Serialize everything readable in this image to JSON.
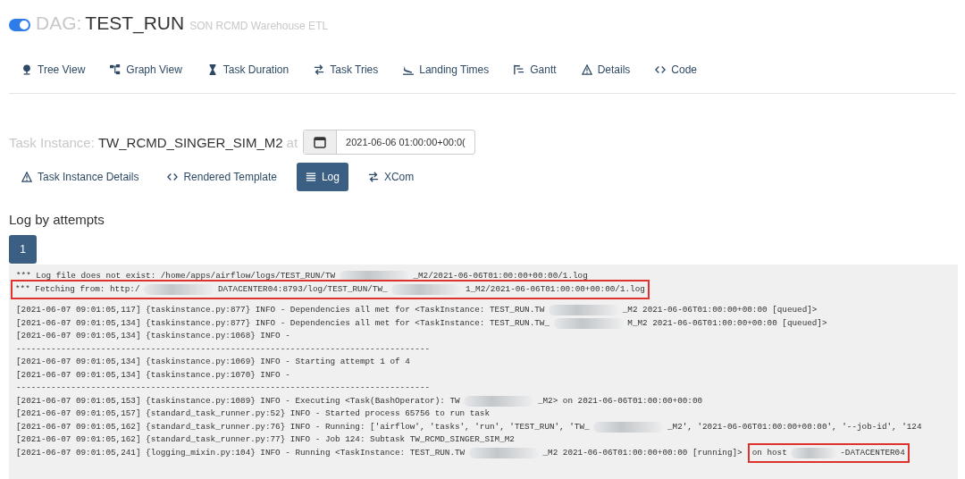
{
  "dag": {
    "on": true,
    "label": "DAG:",
    "name": "TEST_RUN",
    "description": "SON RCMD Warehouse ETL"
  },
  "nav": [
    {
      "label": "Tree View"
    },
    {
      "label": "Graph View"
    },
    {
      "label": "Task Duration"
    },
    {
      "label": "Task Tries"
    },
    {
      "label": "Landing Times"
    },
    {
      "label": "Gantt"
    },
    {
      "label": "Details"
    },
    {
      "label": "Code"
    }
  ],
  "task_instance": {
    "label": "Task Instance:",
    "name": "TW_RCMD_SINGER_SIM_M2",
    "at": "at",
    "date": "2021-06-06 01:00:00+00:0("
  },
  "tabs": [
    {
      "label": "Task Instance Details",
      "selected": false
    },
    {
      "label": "Rendered Template",
      "selected": false
    },
    {
      "label": "Log",
      "selected": true
    },
    {
      "label": "XCom",
      "selected": false
    }
  ],
  "log_heading": "Log by attempts",
  "attempts": [
    {
      "label": "1",
      "selected": true
    }
  ],
  "log_lines": [
    {
      "kind": "text",
      "highlighted": false,
      "segments": [
        "*** Log file does not exist: /home/apps/airflow/logs/TEST_RUN/TW",
        "_M2/2021-06-06T01:00:00+00:00/1.log"
      ]
    },
    {
      "kind": "text",
      "highlighted": true,
      "segments": [
        "*** Fetching from: http:/",
        "DATACENTER04:8793/log/TEST_RUN/TW_",
        "1_M2/2021-06-06T01:00:00+00:00/1.log"
      ]
    },
    {
      "kind": "blank"
    },
    {
      "kind": "text",
      "highlighted": false,
      "segments": [
        "[2021-06-07 09:01:05,117] {taskinstance.py:877} INFO - Dependencies all met for <TaskInstance: TEST_RUN.TW",
        "_M2 2021-06-06T01:00:00+00:00 [queued]>"
      ]
    },
    {
      "kind": "text",
      "highlighted": false,
      "segments": [
        "[2021-06-07 09:01:05,134] {taskinstance.py:877} INFO - Dependencies all met for <TaskInstance: TEST_RUN.TW_",
        "M_M2 2021-06-06T01:00:00+00:00 [queued]>"
      ]
    },
    {
      "kind": "text",
      "highlighted": false,
      "segments": [
        "[2021-06-07 09:01:05,134] {taskinstance.py:1068} INFO -"
      ]
    },
    {
      "kind": "text",
      "highlighted": false,
      "segments": [
        "-----------------------------------------------------------------------------------"
      ]
    },
    {
      "kind": "text",
      "highlighted": false,
      "segments": [
        "[2021-06-07 09:01:05,134] {taskinstance.py:1069} INFO - Starting attempt 1 of 4"
      ]
    },
    {
      "kind": "text",
      "highlighted": false,
      "segments": [
        "[2021-06-07 09:01:05,134] {taskinstance.py:1070} INFO -"
      ]
    },
    {
      "kind": "text",
      "highlighted": false,
      "segments": [
        "-----------------------------------------------------------------------------------"
      ]
    },
    {
      "kind": "text",
      "highlighted": false,
      "segments": [
        "[2021-06-07 09:01:05,153] {taskinstance.py:1089} INFO - Executing <Task(BashOperator): TW",
        "_M2> on 2021-06-06T01:00:00+00:00"
      ]
    },
    {
      "kind": "text",
      "highlighted": false,
      "segments": [
        "[2021-06-07 09:01:05,157] {standard_task_runner.py:52} INFO - Started process 65756 to run task"
      ]
    },
    {
      "kind": "text",
      "highlighted": false,
      "segments": [
        "[2021-06-07 09:01:05,162] {standard_task_runner.py:76} INFO - Running: ['airflow', 'tasks', 'run', 'TEST_RUN', 'TW_",
        "_M2', '2021-06-06T01:00:00+00:00', '--job-id', '124"
      ]
    },
    {
      "kind": "text",
      "highlighted": false,
      "segments": [
        "[2021-06-07 09:01:05,162] {standard_task_runner.py:77} INFO - Job 124: Subtask TW_RCMD_SINGER_SIM_M2"
      ]
    },
    {
      "kind": "text",
      "highlighted": false,
      "segments": [
        "[2021-06-07 09:01:05,241] {logging_mixin.py:104} INFO - Running <TaskInstance: TEST_RUN.TW",
        "_M2 2021-06-06T01:00:00+00:00 [running]>"
      ],
      "callout": {
        "segments": [
          "on host",
          "-DATACENTER04"
        ]
      }
    }
  ]
}
